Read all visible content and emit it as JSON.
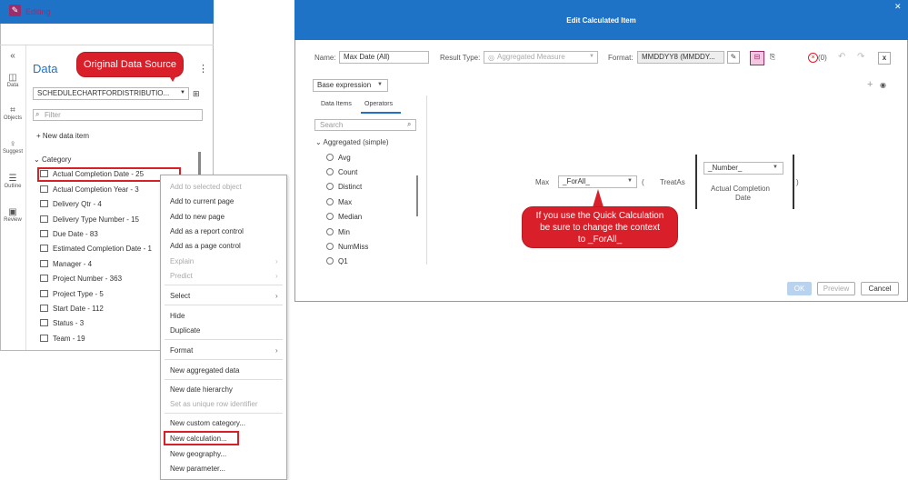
{
  "left_panel": {
    "mode_label": "Editing",
    "title": "Data",
    "data_source": "SCHEDULECHARTFORDISTRIBUTIO...",
    "filter_placeholder": "Filter",
    "new_data_item": "New data item",
    "category_heading": "Category",
    "rail": [
      {
        "label": "Data",
        "icon": "data-icon"
      },
      {
        "label": "Objects",
        "icon": "objects-icon"
      },
      {
        "label": "Suggest",
        "icon": "suggest-icon"
      },
      {
        "label": "Outline",
        "icon": "outline-icon"
      },
      {
        "label": "Review",
        "icon": "review-icon"
      }
    ],
    "items": [
      "Actual Completion Date - 25",
      "Actual Completion Year - 3",
      "Delivery Qtr - 4",
      "Delivery Type Number - 15",
      "Due Date - 83",
      "Estimated Completion Date - 1",
      "Manager - 4",
      "Project Number - 363",
      "Project Type - 5",
      "Start Date - 112",
      "Status - 3",
      "Team - 19"
    ]
  },
  "callouts": {
    "original_source": "Original Data Source",
    "quick_calc_line1": "If you use the Quick Calculation",
    "quick_calc_line2": "be sure to change the context",
    "quick_calc_line3": "to _ForAll_"
  },
  "context_menu": {
    "items": [
      "Add to selected object",
      "Add to current page",
      "Add to new page",
      "Add as a report control",
      "Add as a page control",
      "Explain",
      "Predict",
      "Select",
      "Hide",
      "Duplicate",
      "Format",
      "New aggregated data",
      "New date hierarchy",
      "Set as unique row identifier",
      "New custom category...",
      "New calculation...",
      "New geography...",
      "New parameter..."
    ]
  },
  "dialog": {
    "title": "Edit Calculated Item",
    "name_label": "Name:",
    "name_value": "Max Date (All)",
    "result_type_label": "Result Type:",
    "result_type_value": "Aggregated Measure",
    "format_label": "Format:",
    "format_value": "MMDDYY8 (MMDDY...",
    "error_count": "(0)",
    "base_expression": "Base expression",
    "tabs": [
      "Data Items",
      "Operators"
    ],
    "search_placeholder": "Search",
    "group_label": "Aggregated (simple)",
    "operators": [
      "Avg",
      "Count",
      "Distinct",
      "Max",
      "Median",
      "Min",
      "NumMiss",
      "Q1"
    ],
    "expr_func": "Max",
    "expr_context": "_ForAll_",
    "expr_paren_open": "(",
    "expr_treatas": "TreatAs",
    "expr_number": "_Number_",
    "expr_field_line1": "Actual Completion",
    "expr_field_line2": "Date",
    "expr_paren_close": ")",
    "ok": "OK",
    "preview": "Preview",
    "cancel": "Cancel"
  },
  "colors": {
    "brand_blue": "#1f73c7",
    "highlight_red": "#d9202a",
    "editing_magenta": "#9c2d6c"
  }
}
